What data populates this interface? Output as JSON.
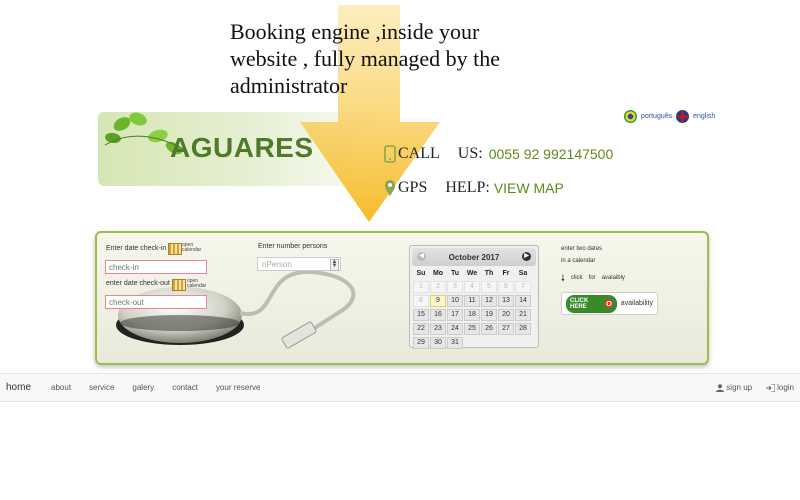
{
  "promo": {
    "line1": "Booking engine ,inside your",
    "line2": "website ,  fully managed by the",
    "line3": "administrator"
  },
  "brand": {
    "name": "AGUARES"
  },
  "languages": [
    {
      "label": "português",
      "icon": "brazil-flag-icon"
    },
    {
      "label": "english",
      "icon": "uk-flag-icon"
    }
  ],
  "contact": {
    "call_label": "CALL",
    "us_label": "US:",
    "phone": "0055 92 992147500",
    "gps_label": "GPS",
    "help_label": "HELP:",
    "map_link": "VIEW MAP"
  },
  "booking": {
    "checkin_label": "Enter date check-in",
    "checkin_placeholder": "check-in",
    "checkout_label": "enter date check-out",
    "checkout_placeholder": "check-out",
    "calendar_icon_text": "open calendar",
    "persons_label": "Enter number persons",
    "persons_placeholder": "nPerson",
    "hint_line1": "enter two dates",
    "hint_line2": "in a calendar",
    "click_words": [
      "click",
      "for",
      "avalaibly"
    ],
    "click_here": "CLICK HERE",
    "availability_label": "availability"
  },
  "calendar": {
    "month": "October 2017",
    "weekdays": [
      "Su",
      "Mo",
      "Tu",
      "We",
      "Th",
      "Fr",
      "Sa"
    ],
    "rows": [
      [
        "1",
        "2",
        "3",
        "4",
        "5",
        "6",
        "7"
      ],
      [
        "8",
        "9",
        "10",
        "11",
        "12",
        "13",
        "14"
      ],
      [
        "15",
        "16",
        "17",
        "18",
        "19",
        "20",
        "21"
      ],
      [
        "22",
        "23",
        "24",
        "25",
        "26",
        "27",
        "28"
      ],
      [
        "29",
        "30",
        "31",
        "",
        "",
        "",
        ""
      ]
    ],
    "disabled_days": [
      "1",
      "2",
      "3",
      "4",
      "5",
      "6",
      "7",
      "8"
    ],
    "today": "9"
  },
  "nav": {
    "left": [
      "home",
      "about",
      "service",
      "galery",
      "contact",
      "your reserve"
    ],
    "signup": "sign up",
    "login": "login"
  },
  "colors": {
    "accent_green": "#5e8a1a",
    "panel_border": "#9bbf4e",
    "arrow_yellow": "#f6c53c"
  }
}
